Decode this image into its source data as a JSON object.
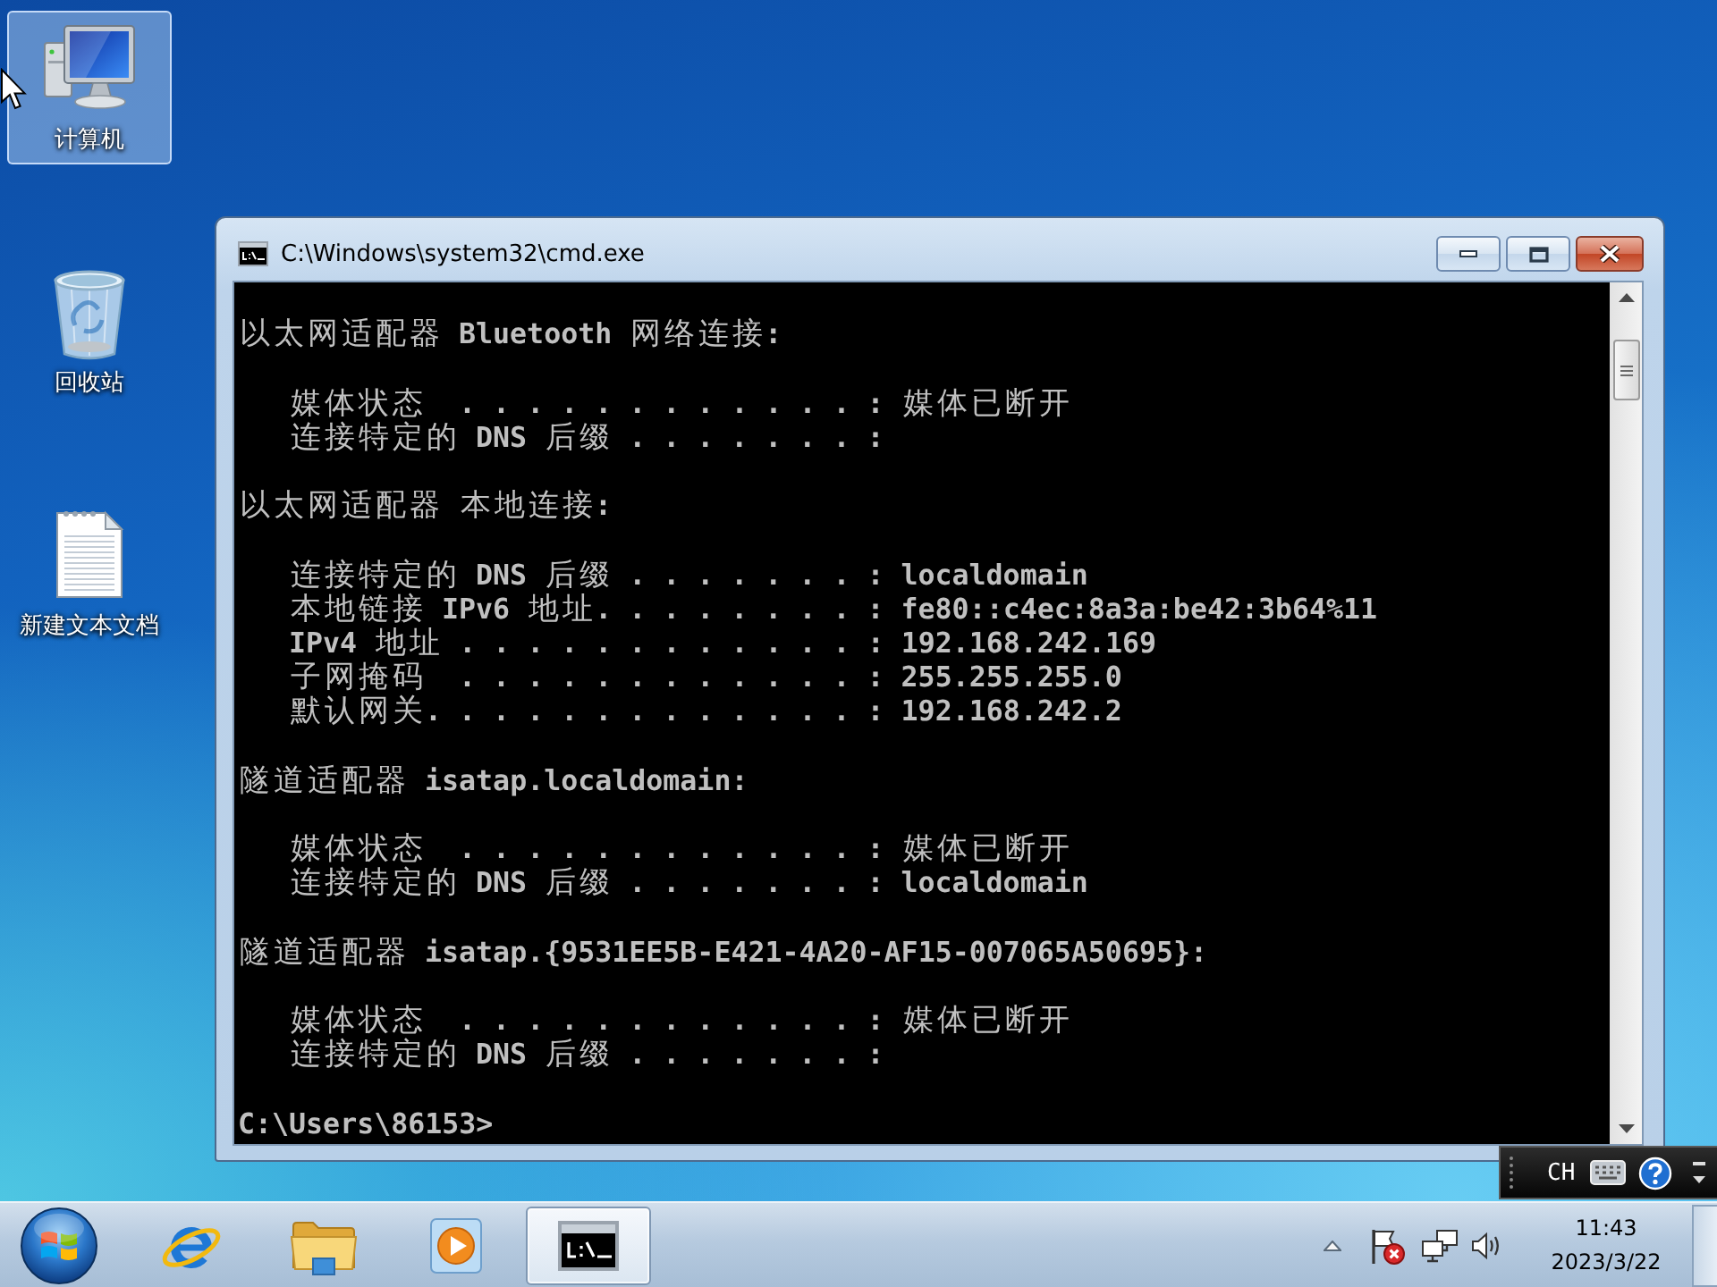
{
  "desktop": {
    "icons": [
      {
        "kind": "computer",
        "label": "计算机",
        "selected": true
      },
      {
        "kind": "recycle-bin",
        "label": "回收站",
        "selected": false
      },
      {
        "kind": "text-file",
        "label": "新建文本文档",
        "selected": false
      }
    ]
  },
  "window": {
    "title": "C:\\Windows\\system32\\cmd.exe",
    "console": {
      "sections": [
        {
          "heading": "以太网适配器 Bluetooth 网络连接:",
          "lines": [
            "媒体状态  . . . . . . . . . . . . : 媒体已断开",
            "连接特定的 DNS 后缀 . . . . . . . :"
          ]
        },
        {
          "heading": "以太网适配器 本地连接:",
          "lines": [
            "连接特定的 DNS 后缀 . . . . . . . : localdomain",
            "本地链接 IPv6 地址. . . . . . . . : fe80::c4ec:8a3a:be42:3b64%11",
            "IPv4 地址 . . . . . . . . . . . . : 192.168.242.169",
            "子网掩码  . . . . . . . . . . . . : 255.255.255.0",
            "默认网关. . . . . . . . . . . . . : 192.168.242.2"
          ]
        },
        {
          "heading": "隧道适配器 isatap.localdomain:",
          "lines": [
            "媒体状态  . . . . . . . . . . . . : 媒体已断开",
            "连接特定的 DNS 后缀 . . . . . . . : localdomain"
          ]
        },
        {
          "heading": "隧道适配器 isatap.{9531EE5B-E421-4A20-AF15-007065A50695}:",
          "lines": [
            "媒体状态  . . . . . . . . . . . . : 媒体已断开",
            "连接特定的 DNS 后缀 . . . . . . . :"
          ]
        }
      ],
      "prompt": "C:\\Users\\86153>"
    }
  },
  "language_bar": {
    "language": "CH"
  },
  "taskbar": {
    "apps": [
      {
        "kind": "browser",
        "active": false
      },
      {
        "kind": "folders",
        "active": false
      },
      {
        "kind": "media",
        "active": false
      },
      {
        "kind": "terminal",
        "active": true
      }
    ],
    "tray": [
      {
        "kind": "show-hidden"
      },
      {
        "kind": "action-center"
      },
      {
        "kind": "network"
      },
      {
        "kind": "volume"
      }
    ],
    "clock": {
      "time": "11:43",
      "date": "2023/3/22"
    }
  }
}
